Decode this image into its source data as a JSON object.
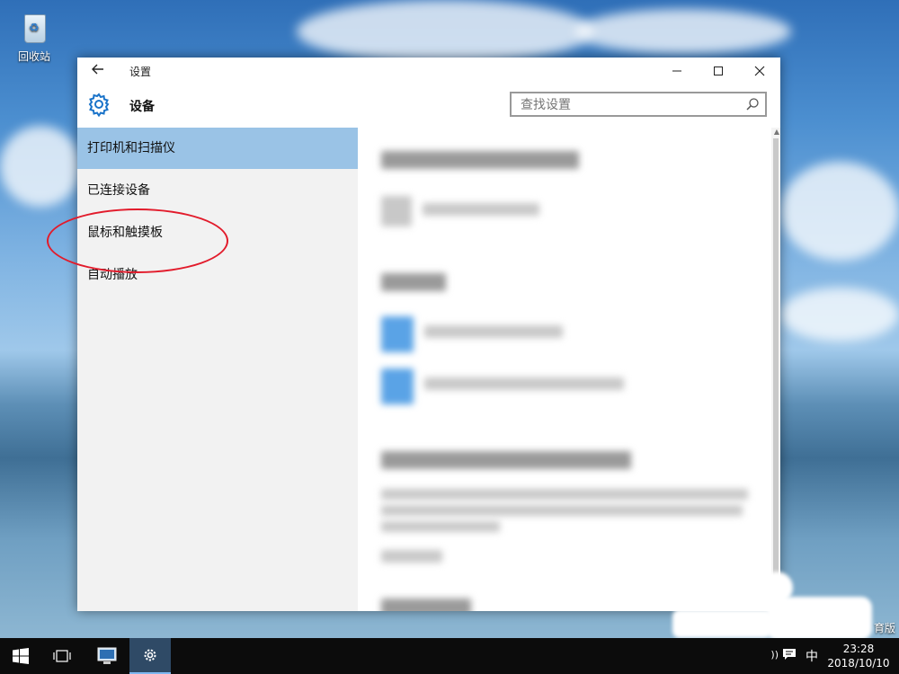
{
  "desktop": {
    "recycle_bin_label": "回收站",
    "corner_text": "育版"
  },
  "window": {
    "title": "设置",
    "header_title": "设备",
    "search_placeholder": "查找设置",
    "controls": {
      "minimize": "—",
      "maximize": "☐",
      "close": "✕"
    }
  },
  "sidebar": {
    "items": [
      {
        "label": "打印机和扫描仪",
        "selected": true
      },
      {
        "label": "已连接设备",
        "selected": false
      },
      {
        "label": "鼠标和触摸板",
        "selected": false
      },
      {
        "label": "自动播放",
        "selected": false
      }
    ]
  },
  "annotation": {
    "color": "#e21b2b",
    "target": "鼠标和触摸板"
  },
  "taskbar": {
    "ime": "中",
    "time": "23:28",
    "date": "2018/10/10"
  },
  "colors": {
    "accent": "#9ac3e6",
    "taskbar": "#0c0c0c"
  },
  "icons": [
    "back-icon",
    "gear-icon",
    "search-icon",
    "windows-start-icon",
    "task-view-icon",
    "remote-desktop-icon",
    "settings-icon",
    "volume-icon",
    "action-center-icon"
  ]
}
